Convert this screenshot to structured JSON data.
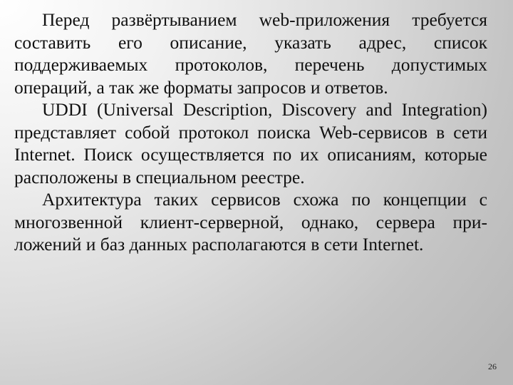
{
  "slide": {
    "paragraphs": [
      "Перед развёртыванием web-приложения требуется составить его описание, указать адрес, список поддерживаемых протоколов, перечень допустимых операций, а так же форматы запросов и ответов.",
      "UDDI (Universal Description, Discovery and Integration) представляет собой протокол поиска Web-сервисов в сети Internet. Поиск осуществляется по их описаниям, которые расположены в специальном реестре.",
      "Архитектура таких сервисов схожа по концепции с многозвенной клиент-серверной, однако, сервера при- ложений и баз данных располагаются в сети Internet."
    ],
    "page_number": "26"
  }
}
